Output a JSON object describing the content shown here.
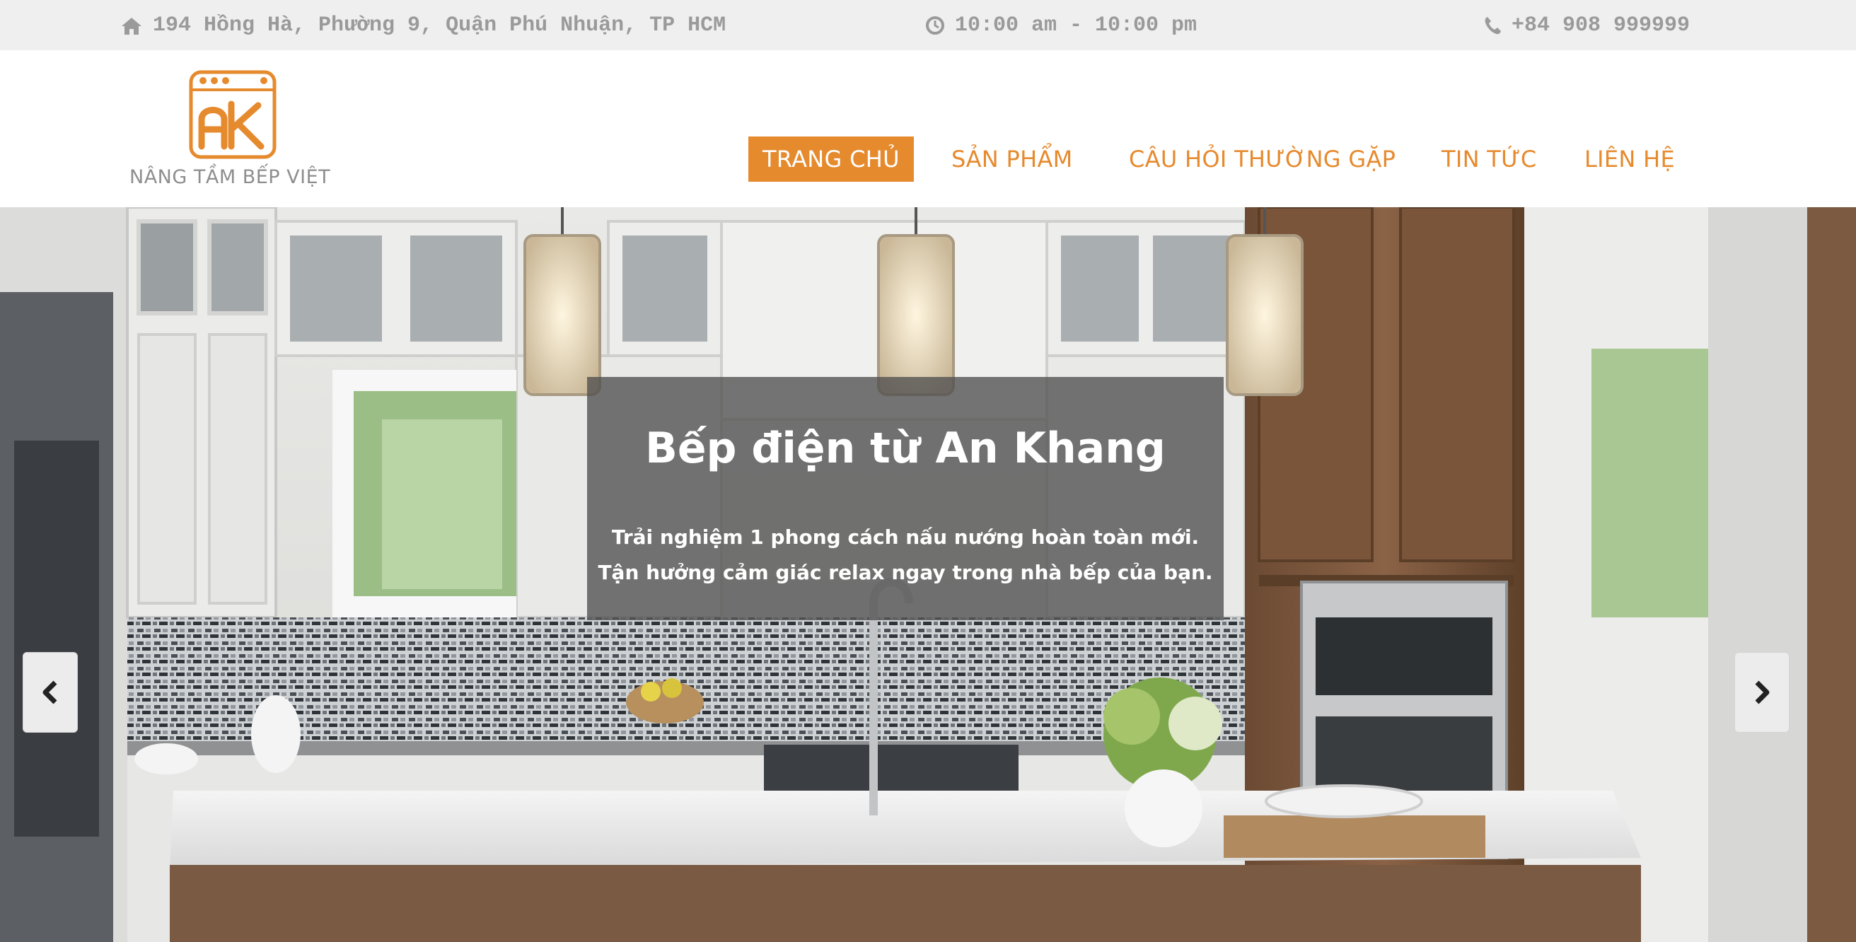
{
  "topbar": {
    "address": "194 Hồng Hà, Phường 9, Quận Phú Nhuận, TP HCM",
    "hours": "10:00 am - 10:00 pm",
    "phone": "+84 908 999999",
    "icons": [
      "home-icon",
      "clock-icon",
      "phone-icon"
    ]
  },
  "brand": {
    "logo_letters": "AK",
    "tagline": "NÂNG TẦM BẾP VIỆT",
    "accent_color": "#e68a2e"
  },
  "nav": {
    "items": [
      {
        "label": "TRANG CHỦ",
        "active": true
      },
      {
        "label": "SẢN PHẨM",
        "active": false
      },
      {
        "label": "CÂU HỎI THƯỜNG GẶP",
        "active": false
      },
      {
        "label": "TIN TỨC",
        "active": false
      },
      {
        "label": "LIÊN HỆ",
        "active": false
      }
    ]
  },
  "hero": {
    "title": "Bếp điện từ An Khang",
    "line1": "Trải nghiệm 1 phong cách nấu nướng hoàn toàn mới.",
    "line2": "Tận hưởng cảm giác relax ngay trong nhà bếp của bạn.",
    "prev_icon": "chevron-left-icon",
    "next_icon": "chevron-right-icon"
  }
}
